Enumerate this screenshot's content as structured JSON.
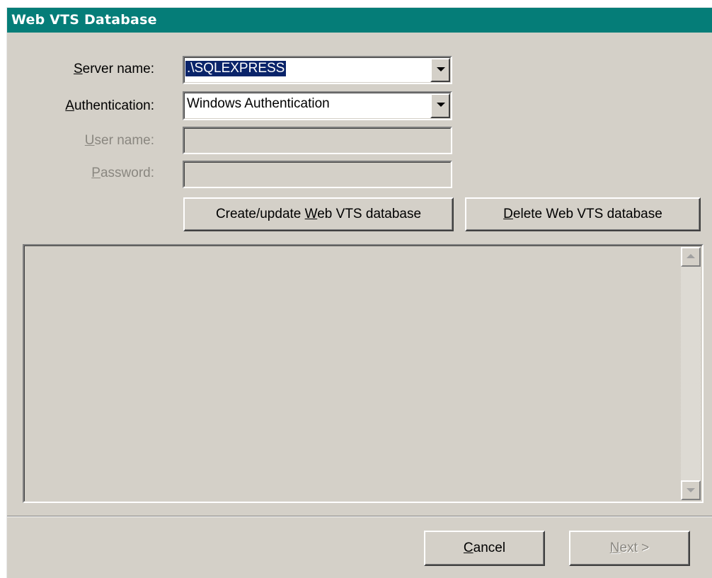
{
  "window": {
    "title": "Web VTS Database"
  },
  "form": {
    "server": {
      "label_prefix": "",
      "label_access": "S",
      "label_rest": "erver name:",
      "value": ".\\SQLEXPRESS"
    },
    "auth": {
      "label_access": "A",
      "label_rest": "uthentication:",
      "value": "Windows Authentication"
    },
    "user": {
      "label_access": "U",
      "label_rest": "ser name:",
      "value": ""
    },
    "password": {
      "label_access": "P",
      "label_rest": "assword:",
      "value": ""
    }
  },
  "actions": {
    "create": {
      "pre": "Create/update ",
      "access": "W",
      "post": "eb VTS database"
    },
    "delete": {
      "pre": "",
      "access": "D",
      "post": "elete Web VTS database"
    }
  },
  "log": {
    "text": ""
  },
  "footer": {
    "cancel": {
      "access": "C",
      "post": "ancel"
    },
    "next": {
      "access": "N",
      "post": "ext >"
    }
  },
  "colors": {
    "titlebar": "#057d78",
    "face": "#d4d0c8",
    "selection": "#0a246a"
  }
}
